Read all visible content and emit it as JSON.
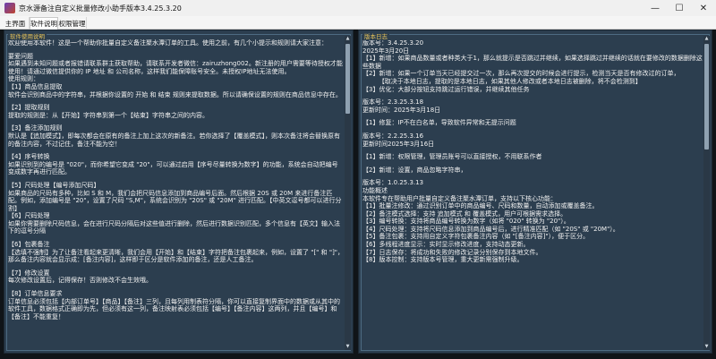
{
  "window": {
    "title": "京水源备注自定义批量修改小助手版本3.4.25.3.20",
    "controls": {
      "minimize": "—",
      "maximize": "☐",
      "close": "✕"
    }
  },
  "tabs": [
    {
      "label": "主界面",
      "active": false
    },
    {
      "label": "软件说明",
      "active": true
    },
    {
      "label": "权限管理",
      "active": false
    }
  ],
  "left_panel": {
    "legend": "软件使用说明",
    "lines": [
      "欢迎使用本软件！这是一个帮助你批量自定义备注聚水潭订单的工具。使用之前，有几个小提示和规则请大家注意：",
      "",
      "要爱问题",
      "如果遇到未知问题或者报错请联系群主获取帮助，请联系开发者微信：zairuzhong002。新注册的用户需要等待授权才能使用！请通过微信提供你的 IP 地址 和 公司名称，这样我们能保障账号安全。未授权IP地址无法使用。",
      "使用规则：",
      "【1】商品信息提取",
      "软件会识别商品中的字符串，并根据你设置的 开始 和 结束 规则来提取数据。所以请确保设置的规则在商品信息中存在。",
      "",
      "【2】提取规则",
      "提取的规则是：从【开始】字符串到第一个【结束】字符串之间的内容。",
      "",
      "【3】备注添加规则",
      "默认是【追加模式】，即每次都会在原有的备注上加上这次的新备注。若你选择了【覆盖模式】，则本次备注将会替换原有的备注内容，不过记住，备注不能为空！",
      "",
      "【4】序号转换",
      "如果识别到的编号是 \"020\"，而你希望它变成 \"20\"，可以通过启用【序号尽量转换为数字】的功能，系统会自动把编号变成数字再进行匹配。",
      "",
      "【5】尺码处理【编号添加尺码】",
      "如果商品的尺码有多种，比如 S 和 M，我们会把尺码信息添加到商品编号后面。然后根据 20S 或 20M 来进行备注匹配。例如，添加编号是 \"20\"，设置了尺码 \"S,M\"，系统会识别为 \"20S\" 或 \"20M\" 进行匹配。【中英文逗号都可以进行分割】",
      "【6】尺码处理",
      "如果你需要删除尺码信息，会在进行尺码分隔后对这些值进行删除，然后进行数据识别匹配，多个信息有【英文】输入法下的逗号分隔",
      "",
      "【6】包裹备注",
      "【选填不强制】为了让备注看起来更清晰，我们会用【开始】和【结束】字符把备注包裹起来，例如，设置了 \"[\" 和 \"]\"，那么备注内容就会显示成：[备注内容]，这样即于区分是软件添加的备注，还是人工备注。",
      "",
      "【7】修改设置",
      "每次修改设置后，记得保存！否则修改不会生效哦。",
      "",
      "【8】订单信息要求",
      "订单信息必须包括【内部订单号】【商品】【备注】三列，且每列用制表符分隔，你可以直接复制界面中的数据或从其中的软件工具，数据格式正确即为先，但必须有这一列，备注映射表必须包括【编号】【备注内容】这两列，并且【编号】和【备注】不能重复！"
    ]
  },
  "right_panel": {
    "legend": "版本日志",
    "lines": [
      "版本号：3.4.25.3.20",
      "2025年3月20日",
      "【1】新增：如果商品数量或者种类大于1，那么就提示是否跳过并继续，如果选择跳过并继续的话就在要修改的数据删除这些数据",
      "【2】新增：如果一个订单当天已经提交过一次，那么再次提交的时候会进行提示，检测当天是否有修改过的订单，",
      "        【取决于本地日志，提取的是本地日志，如果其他人修改或者本地日志被删除，将不会检测到】",
      "【3】优化：大部分按钮支持跳过运行错误，并继续其他任务",
      "",
      "版本号：2.3.25.3.18",
      "更新时间：2025年3月18日",
      "",
      "【1】修复：IP不在白名单，导致软件异常和无提示问题",
      "",
      "版本号：2.2.25.3.16",
      "更新时间2025年3月16日",
      "",
      "【1】新增：权限管理，管理员账号可以直接授权，不用联系作者",
      "",
      "【2】新增：设置，商品忽略字符串，",
      "",
      "版本号：1.0.25.3.13",
      "功能概述",
      "本软件专在帮助用户批量自定义备注聚水潭订单，支持以下核心功能：",
      "【1】批量注修改：通过识别订单中的商品编号、尺码和数量，自动添加或覆盖备注。",
      "【2】备注模式选择：支持 追加模式 和 覆盖模式，用户可根据需求选择。",
      "【3】编号转换：支持将商品编号转换为数字（如将 \"020\" 转换为 \"20\"）。",
      "【4】尺码处理：支持将尺码信息添加到商品编号后，进行精准匹配（如 \"20S\" 或 \"20M\"）。",
      "【5】备注包裹：支持用自定义字符包裹备注内容（如 \"[备注内容]\"），便于区分。",
      "【6】多线程进度显示：实时显示修改进度，支持动态更新。",
      "【7】日志保存：将成功和失败的修改记录分别保存到本地文件。",
      "【8】版本控制：支持版本号管理，重大更新需强制升级。"
    ]
  }
}
